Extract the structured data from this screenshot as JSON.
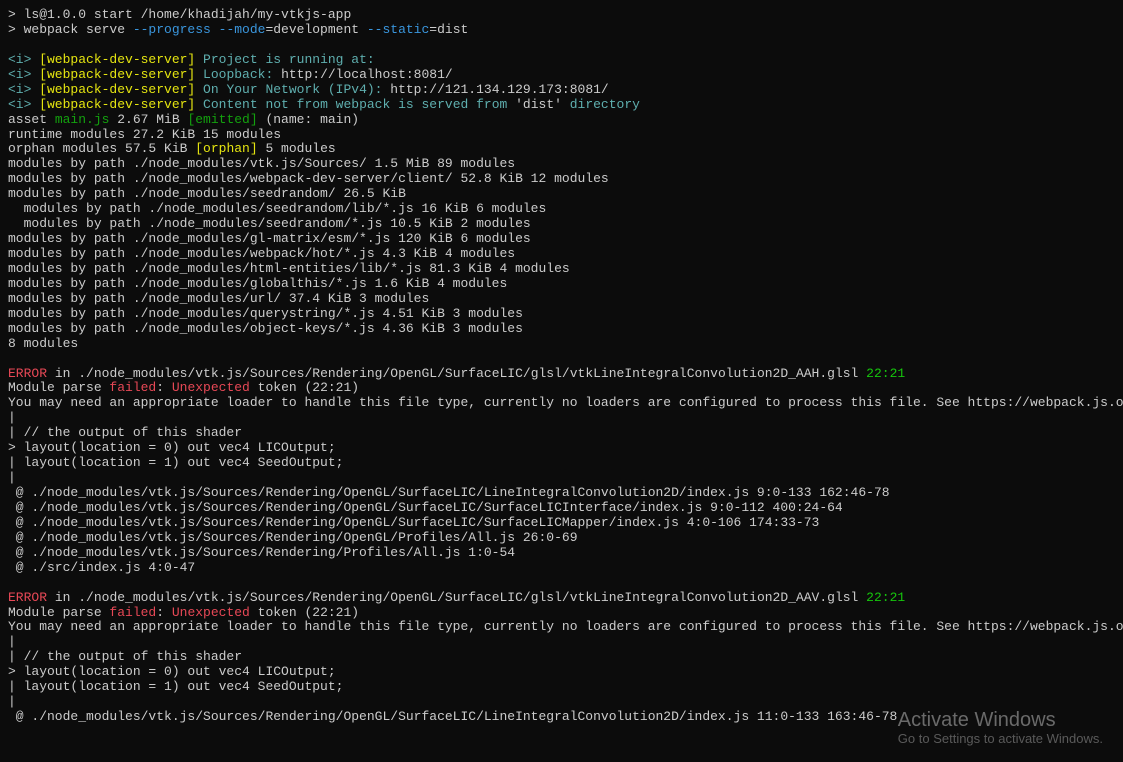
{
  "cmd1": "> ls@1.0.0 start /home/khadijah/my-vtkjs-app",
  "cmd2_prefix": "> webpack serve ",
  "cmd2_flag1": "--progress",
  "cmd2_flag2": " --mode",
  "cmd2_eq1": "=development ",
  "cmd2_flag3": "--static",
  "cmd2_eq2": "=dist",
  "blank": " ",
  "i_tag": "<i>",
  "wds": " [webpack-dev-server] ",
  "wds1_text": "Project is running at:",
  "wds2_text": "Loopback: ",
  "wds2_url": "http://localhost:8081/",
  "wds3_text": "On Your Network (IPv4): ",
  "wds3_url": "http://121.134.129.173:8081/",
  "wds4_text1": "Content not from webpack is served from ",
  "wds4_text2": "'dist'",
  "wds4_text3": " directory",
  "asset1": "asset ",
  "asset2": "main.js",
  "asset3": " 2.67 MiB ",
  "asset4": "[emitted]",
  "asset5": " (name: main)",
  "runtime": "runtime modules 27.2 KiB 15 modules",
  "orphan1": "orphan modules 57.5 KiB ",
  "orphan2": "[orphan]",
  "orphan3": " 5 modules",
  "mod1": "modules by path ./node_modules/vtk.js/Sources/ 1.5 MiB 89 modules",
  "mod2": "modules by path ./node_modules/webpack-dev-server/client/ 52.8 KiB 12 modules",
  "mod3": "modules by path ./node_modules/seedrandom/ 26.5 KiB",
  "mod3a": "  modules by path ./node_modules/seedrandom/lib/*.js 16 KiB 6 modules",
  "mod3b": "  modules by path ./node_modules/seedrandom/*.js 10.5 KiB 2 modules",
  "mod4": "modules by path ./node_modules/gl-matrix/esm/*.js 120 KiB 6 modules",
  "mod5": "modules by path ./node_modules/webpack/hot/*.js 4.3 KiB 4 modules",
  "mod6": "modules by path ./node_modules/html-entities/lib/*.js 81.3 KiB 4 modules",
  "mod7": "modules by path ./node_modules/globalthis/*.js 1.6 KiB 4 modules",
  "mod8": "modules by path ./node_modules/url/ 37.4 KiB 3 modules",
  "mod9": "modules by path ./node_modules/querystring/*.js 4.51 KiB 3 modules",
  "mod10": "modules by path ./node_modules/object-keys/*.js 4.36 KiB 3 modules",
  "mod11": "8 modules",
  "error_label": "ERROR",
  "err1_in": " in ",
  "err1_path": "./node_modules/vtk.js/Sources/Rendering/OpenGL/SurfaceLIC/glsl/vtkLineIntegralConvolution2D_AAH.glsl",
  "err1_loc": " 22:21",
  "mp1": "Module parse ",
  "mp2": "failed",
  "mp3": ": ",
  "mp4": "Unexpected",
  "mp5": " token (22:21)",
  "loader_msg": "You may need an appropriate loader to handle this file type, currently no loaders are configured to process this file. See https://webpack.js.org/concepts#loaders",
  "pipe": "|",
  "comment": "| // the output of this shader",
  "layout1": "> layout(location = 0) out vec4 LICOutput;",
  "layout2": "| layout(location = 1) out vec4 SeedOutput;",
  "at1": " @ ./node_modules/vtk.js/Sources/Rendering/OpenGL/SurfaceLIC/LineIntegralConvolution2D/index.js 9:0-133 162:46-78",
  "at2": " @ ./node_modules/vtk.js/Sources/Rendering/OpenGL/SurfaceLIC/SurfaceLICInterface/index.js 9:0-112 400:24-64",
  "at3": " @ ./node_modules/vtk.js/Sources/Rendering/OpenGL/SurfaceLIC/SurfaceLICMapper/index.js 4:0-106 174:33-73",
  "at4": " @ ./node_modules/vtk.js/Sources/Rendering/OpenGL/Profiles/All.js 26:0-69",
  "at5": " @ ./node_modules/vtk.js/Sources/Rendering/Profiles/All.js 1:0-54",
  "at6": " @ ./src/index.js 4:0-47",
  "err2_path": "./node_modules/vtk.js/Sources/Rendering/OpenGL/SurfaceLIC/glsl/vtkLineIntegralConvolution2D_AAV.glsl",
  "err2_loc": " 22:21",
  "at7": " @ ./node_modules/vtk.js/Sources/Rendering/OpenGL/SurfaceLIC/LineIntegralConvolution2D/index.js 11:0-133 163:46-78",
  "watermark_title": "Activate Windows",
  "watermark_sub": "Go to Settings to activate Windows."
}
